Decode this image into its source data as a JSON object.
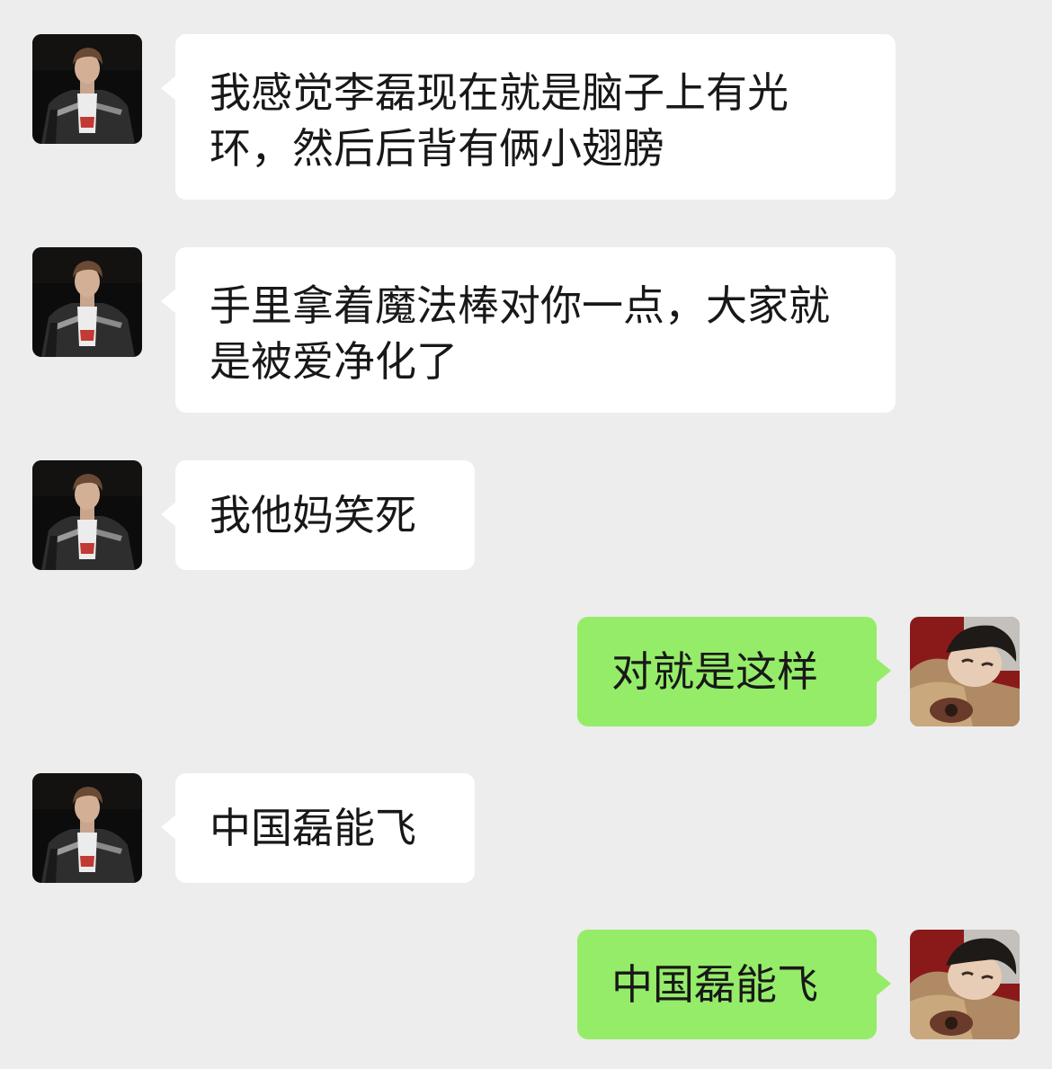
{
  "colors": {
    "background": "#ededed",
    "incoming_bubble": "#ffffff",
    "outgoing_bubble": "#95ec69",
    "text": "#181818"
  },
  "messages": [
    {
      "direction": "incoming",
      "text": "我感觉李磊现在就是脑子上有光环，然后后背有俩小翅膀",
      "avatar": "contact-avatar"
    },
    {
      "direction": "incoming",
      "text": "手里拿着魔法棒对你一点，大家就是被爱净化了",
      "avatar": "contact-avatar"
    },
    {
      "direction": "incoming",
      "text": "我他妈笑死",
      "avatar": "contact-avatar"
    },
    {
      "direction": "outgoing",
      "text": "对就是这样",
      "avatar": "self-avatar"
    },
    {
      "direction": "incoming",
      "text": "中国磊能飞",
      "avatar": "contact-avatar"
    },
    {
      "direction": "outgoing",
      "text": "中国磊能飞",
      "avatar": "self-avatar"
    }
  ]
}
